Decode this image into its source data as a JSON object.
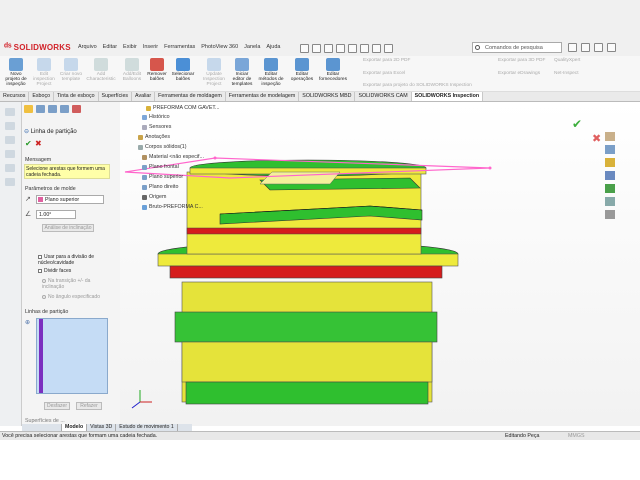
{
  "app": {
    "name": "SOLIDWORKS"
  },
  "menu": [
    "Arquivo",
    "Editar",
    "Exibir",
    "Inserir",
    "Ferramentas",
    "PhotoView 360",
    "Janela",
    "Ajuda"
  ],
  "search": {
    "placeholder": "Comandos de pesquisa"
  },
  "ribbon": {
    "buttons": [
      {
        "label": "Novo projeto de inspeção",
        "enabled": true
      },
      {
        "label": "Edit inspection Project",
        "enabled": false
      },
      {
        "label": "Criar novo template",
        "enabled": false
      },
      {
        "label": "Add Characteristic",
        "enabled": false
      },
      {
        "label": "Add/Edit Balloons",
        "enabled": false
      },
      {
        "label": "Remover balões",
        "enabled": true
      },
      {
        "label": "Selecionar balões",
        "enabled": true
      },
      {
        "label": "Update Inspection Project",
        "enabled": false
      },
      {
        "label": "Iniciar editor de templates",
        "enabled": true
      },
      {
        "label": "Editar métodos de inspeção",
        "enabled": true
      },
      {
        "label": "Editar operações",
        "enabled": true
      },
      {
        "label": "Editar fornecedores",
        "enabled": true
      }
    ],
    "export": [
      "Exportar para 2D PDF",
      "Exportar para Excel",
      "Exportar para projeto do SOLIDWORKS Inspection",
      "Exportar para 3D PDF",
      "Exportar eDrawings",
      "QualityXpert",
      "Net-Inspect"
    ]
  },
  "tabs": [
    "Recursos",
    "Esboço",
    "Tinta de esboço",
    "Superfícies",
    "Avaliar",
    "Ferramentas de moldagem",
    "Ferramentas de modelagem",
    "SOLIDWORKS MBD",
    "SOLIDWORKS CAM",
    "SOLIDWORKS Inspection"
  ],
  "active_tab": "SOLIDWORKS Inspection",
  "property_manager": {
    "title": "Linha de partição",
    "message_header": "Mensagem",
    "message": "Selecione arestas que formem uma cadeia fechada.",
    "mold_params_header": "Parâmetros de molde",
    "direction_plane": "Plano superior",
    "angle": "1.00°",
    "draft_button": "Análise de inclinação",
    "colors": [
      "#00cc00",
      "#ffff00",
      "#ff0000",
      "#0000ff"
    ],
    "use_for_split": "Usar para a divisão de núcleo/cavidade",
    "split_faces": "Dividir faces",
    "at_transition": "Na transição +/- da inclinação",
    "at_angle": "No ângulo especificado",
    "edges_header": "Linhas de partição",
    "undo": "Desfazer",
    "reset": "Refazer",
    "more": "Superfícies de ..."
  },
  "tree": {
    "root": "PREFORMA COM GAVET...",
    "items": [
      "Histórico",
      "Sensores",
      "Anotações",
      "Corpos sólidos(1)",
      "Material <não especif...",
      "Plano frontal",
      "Plano superior",
      "Plano direito",
      "Origem",
      "Bruto-PREFORMA C..."
    ]
  },
  "bottom_tabs": [
    "Modelo",
    "Vistas 3D",
    "Estudo de movimento 1"
  ],
  "active_bottom_tab": "Modelo",
  "status": {
    "hint": "Você precisa selecionar arestas que formam uma cadeia fechada.",
    "mode": "Editando Peça",
    "units": "MMGS"
  },
  "part_colors": {
    "body": "#f0ee3a",
    "thread": "#2fbf2f",
    "ring": "#d51c1c",
    "parting_line": "#ff66cc"
  }
}
